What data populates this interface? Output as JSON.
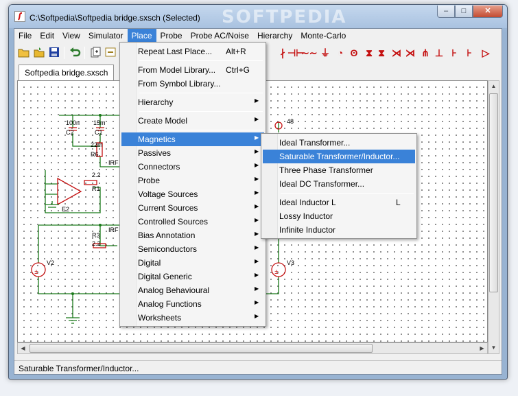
{
  "window": {
    "title": "C:\\Softpedia\\Softpedia bridge.sxsch (Selected)",
    "watermark": "SOFTPEDIA",
    "controls": {
      "minimize": "–",
      "maximize": "□",
      "close": "✕"
    }
  },
  "menubar": [
    "File",
    "Edit",
    "View",
    "Simulator",
    "Place",
    "Probe",
    "Probe AC/Noise",
    "Hierarchy",
    "Monte-Carlo"
  ],
  "toolbar": {
    "icons": [
      "open-folder-icon",
      "open-icon",
      "save-icon",
      "undo-icon",
      "new-icon",
      "place-icon"
    ],
    "symbols": [
      "∤",
      "⊣⊢",
      "∼∼",
      "◔",
      "ʘ",
      "⧗",
      "⧗",
      "⋊",
      "⋊",
      "⋔",
      "⊥",
      "⊦",
      "⊦",
      "▷"
    ]
  },
  "tab": {
    "label": "Softpedia bridge.sxsch"
  },
  "schematic": {
    "labels": [
      "100n",
      "C2",
      "15m",
      "C1",
      "22m",
      "R6",
      "IRF",
      "2.2",
      "R1",
      "E2",
      "R3",
      "2.2",
      "IRF",
      "V2",
      "V3",
      "48"
    ]
  },
  "place_menu": {
    "items": [
      {
        "label": "Repeat Last Place...",
        "shortcut": "Alt+R",
        "submenu": false
      },
      {
        "separator": true
      },
      {
        "label": "From Model Library...",
        "shortcut": "Ctrl+G",
        "submenu": false
      },
      {
        "label": "From Symbol Library...",
        "shortcut": "",
        "submenu": false
      },
      {
        "separator": true
      },
      {
        "label": "Hierarchy",
        "shortcut": "",
        "submenu": true
      },
      {
        "separator": true
      },
      {
        "label": "Create Model",
        "shortcut": "",
        "submenu": true
      },
      {
        "separator": true
      },
      {
        "label": "Magnetics",
        "shortcut": "",
        "submenu": true,
        "highlighted": true
      },
      {
        "label": "Passives",
        "shortcut": "",
        "submenu": true
      },
      {
        "label": "Connectors",
        "shortcut": "",
        "submenu": true
      },
      {
        "label": "Probe",
        "shortcut": "",
        "submenu": true
      },
      {
        "label": "Voltage Sources",
        "shortcut": "",
        "submenu": true
      },
      {
        "label": "Current Sources",
        "shortcut": "",
        "submenu": true
      },
      {
        "label": "Controlled Sources",
        "shortcut": "",
        "submenu": true
      },
      {
        "label": "Bias Annotation",
        "shortcut": "",
        "submenu": true
      },
      {
        "label": "Semiconductors",
        "shortcut": "",
        "submenu": true
      },
      {
        "label": "Digital",
        "shortcut": "",
        "submenu": true
      },
      {
        "label": "Digital Generic",
        "shortcut": "",
        "submenu": true
      },
      {
        "label": "Analog Behavioural",
        "shortcut": "",
        "submenu": true
      },
      {
        "label": "Analog Functions",
        "shortcut": "",
        "submenu": true
      },
      {
        "label": "Worksheets",
        "shortcut": "",
        "submenu": true
      }
    ]
  },
  "magnetics_menu": {
    "items": [
      {
        "label": "Ideal Transformer...",
        "shortcut": ""
      },
      {
        "label": "Saturable Transformer/Inductor...",
        "shortcut": "",
        "highlighted": true
      },
      {
        "label": "Three Phase Transformer",
        "shortcut": ""
      },
      {
        "label": "Ideal DC Transformer...",
        "shortcut": ""
      },
      {
        "separator": true
      },
      {
        "label": "Ideal Inductor L",
        "shortcut": "L"
      },
      {
        "label": "Lossy Inductor",
        "shortcut": ""
      },
      {
        "label": "Infinite Inductor",
        "shortcut": ""
      }
    ]
  },
  "status": {
    "text": "Saturable Transformer/Inductor..."
  },
  "colors": {
    "accent": "#3a82d8",
    "component": "#c41010",
    "wire": "#1a7a1a"
  }
}
